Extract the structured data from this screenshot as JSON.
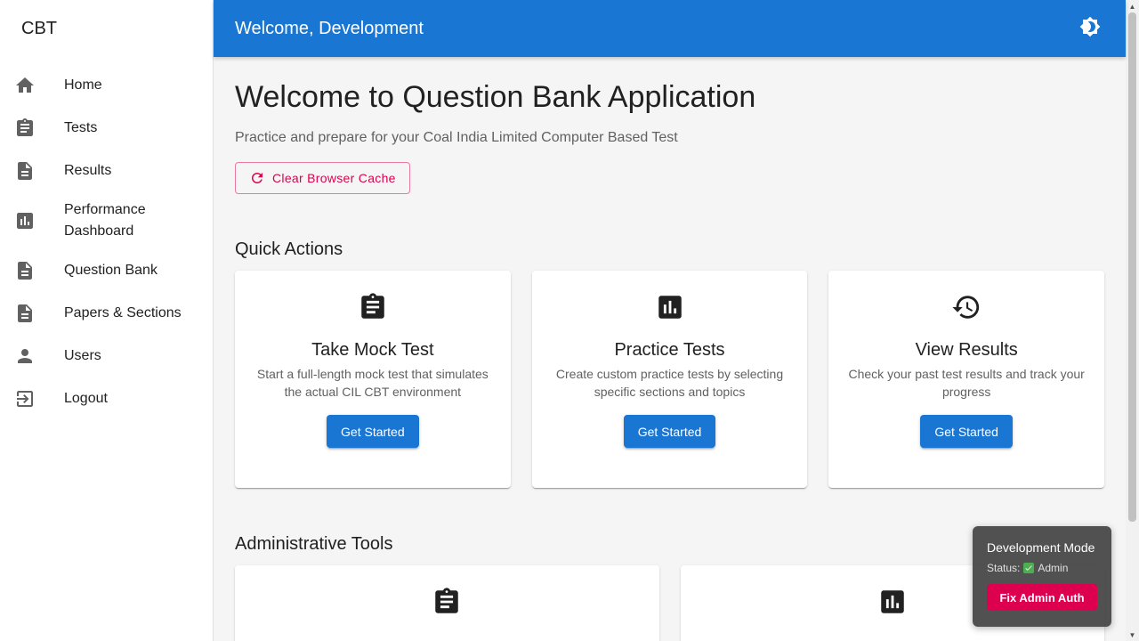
{
  "sidebar": {
    "brand": "CBT",
    "items": [
      {
        "label": "Home",
        "icon": "home-icon"
      },
      {
        "label": "Tests",
        "icon": "assignment-icon"
      },
      {
        "label": "Results",
        "icon": "description-icon"
      },
      {
        "label": "Performance Dashboard",
        "icon": "assessment-icon"
      },
      {
        "label": "Question Bank",
        "icon": "description-icon"
      },
      {
        "label": "Papers & Sections",
        "icon": "description-icon"
      },
      {
        "label": "Users",
        "icon": "person-icon"
      },
      {
        "label": "Logout",
        "icon": "exit-icon"
      }
    ]
  },
  "header": {
    "title": "Welcome, Development",
    "theme_icon": "brightness-icon",
    "color": "#1976d2"
  },
  "main": {
    "title": "Welcome to Question Bank Application",
    "subtitle": "Practice and prepare for your Coal India Limited Computer Based Test",
    "clear_cache_label": "Clear Browser Cache",
    "quick_actions": {
      "title": "Quick Actions",
      "cards": [
        {
          "icon": "assignment-icon",
          "title": "Take Mock Test",
          "description": "Start a full-length mock test that simulates the actual CIL CBT environment",
          "button": "Get Started"
        },
        {
          "icon": "assessment-icon",
          "title": "Practice Tests",
          "description": "Create custom practice tests by selecting specific sections and topics",
          "button": "Get Started"
        },
        {
          "icon": "history-icon",
          "title": "View Results",
          "description": "Check your past test results and track your progress",
          "button": "Get Started"
        }
      ]
    },
    "admin_tools": {
      "title": "Administrative Tools",
      "cards": [
        {
          "icon": "assignment-icon"
        },
        {
          "icon": "assessment-icon"
        }
      ]
    }
  },
  "dev_panel": {
    "title": "Development Mode",
    "status_label": "Status:",
    "status_value": "Admin",
    "button": "Fix Admin Auth",
    "accent": "#dc004e"
  }
}
